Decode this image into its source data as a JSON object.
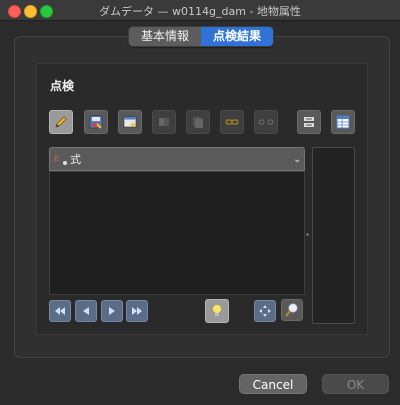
{
  "window": {
    "title": "ダムデータ — w0114g_dam - 地物属性"
  },
  "tabs": [
    {
      "label": "基本情報",
      "selected": false
    },
    {
      "label": "点検結果",
      "selected": true
    }
  ],
  "section": {
    "title": "点検"
  },
  "toolbar": {
    "icons": [
      "pencil-icon",
      "save-edits-icon",
      "form-star-icon",
      "copy-disabled-icon",
      "paste-disabled-icon",
      "link-disabled-icon",
      "unlink-disabled-icon",
      "list-toggle-icon",
      "table-view-icon"
    ]
  },
  "expression": {
    "label": "式"
  },
  "navigation": {
    "icons": [
      "first-icon",
      "previous-icon",
      "next-icon",
      "last-icon",
      "highlight-bulb-icon",
      "pan-to-icon",
      "zoom-to-icon"
    ]
  },
  "dialog": {
    "cancel_label": "Cancel",
    "ok_label": "OK"
  },
  "colors": {
    "accent": "#2f73d9",
    "background": "#2b2b2b"
  }
}
